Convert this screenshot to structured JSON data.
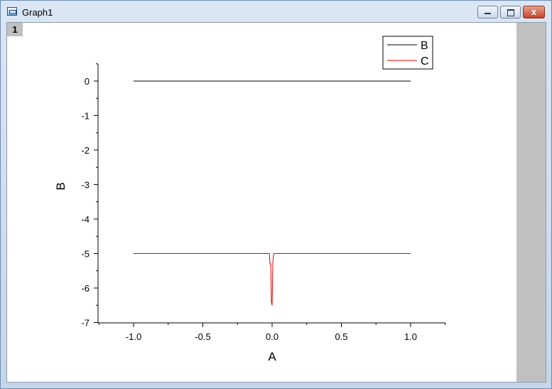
{
  "window": {
    "title": "Graph1",
    "layer_label": "1",
    "close_glyph": "x"
  },
  "chart_data": {
    "type": "line",
    "title": "",
    "xlabel": "A",
    "ylabel": "B",
    "xlim": [
      -1.25,
      1.25
    ],
    "ylim": [
      -7,
      0.5
    ],
    "x_ticks": [
      -1.0,
      -0.5,
      0.0,
      0.5,
      1.0
    ],
    "x_tick_labels": [
      "-1.0",
      "-0.5",
      "0.0",
      "0.5",
      "1.0"
    ],
    "y_ticks": [
      0,
      -1,
      -2,
      -3,
      -4,
      -5,
      -6,
      -7
    ],
    "y_tick_labels": [
      "0",
      "-1",
      "-2",
      "-3",
      "-4",
      "-5",
      "-6",
      "-7"
    ],
    "grid": false,
    "legend_position": "top-right",
    "series": [
      {
        "name": "B",
        "color": "#000000",
        "x": [
          -1.0,
          1.0
        ],
        "y": [
          0,
          0
        ]
      },
      {
        "name": "C",
        "color": "#e00000",
        "x": [
          -1.0,
          -0.02,
          -0.015,
          -0.01,
          -0.005,
          0.0,
          0.005,
          0.01,
          0.015,
          0.02,
          1.0
        ],
        "y": [
          -5,
          -5,
          -5.3,
          -5.3,
          -6.4,
          -6.5,
          -5.3,
          -5.05,
          -5,
          -5,
          -5
        ]
      }
    ]
  }
}
